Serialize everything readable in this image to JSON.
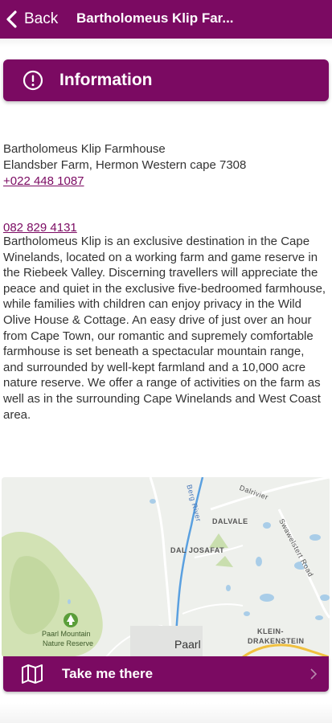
{
  "header": {
    "back_label": "Back",
    "title": "Bartholomeus Klip Far..."
  },
  "section": {
    "title": "Information"
  },
  "details": {
    "name": "Bartholomeus Klip Farmhouse",
    "address": "Elandsber Farm, Hermon Western cape 7308",
    "phone_1": "+022 448 1087",
    "phone_2": "082 829 4131"
  },
  "description": "Bartholomeus Klip is an exclusive destination in the Cape Winelands, located on a working farm and game reserve in the Riebeek Valley. Discerning travellers will appreciate the peace and quiet in the exclusive five-bedroomed farmhouse, while families with children can enjoy privacy in the Wild Olive House & Cottage. An easy drive of just over an hour from Cape Town, our romantic and supremely comfortable farmhouse is set beneath a spectacular mountain range, and surrounded by well-kept farmland and a 10,000 acre nature reserve. We offer a range of activities on the farm as well as in the surrounding Cape Winelands and West Coast area.",
  "map": {
    "labels": {
      "dalvale": "DALVALE",
      "dal_josafat": "DAL JOSAFAT",
      "klein": "KLEIN-",
      "drakenstein": "DRAKENSTEIN",
      "paarl": "Paarl",
      "reserve_line1": "Paarl Mountain",
      "reserve_line2": "Nature Reserve",
      "berg_river": "Berg River",
      "dalrivier": "Dalrivier",
      "swawelstert_road": "Swawelstert Road"
    }
  },
  "cta": {
    "label": "Take me there"
  },
  "colors": {
    "brand": "#7b0a62",
    "link": "#7b0a62"
  }
}
